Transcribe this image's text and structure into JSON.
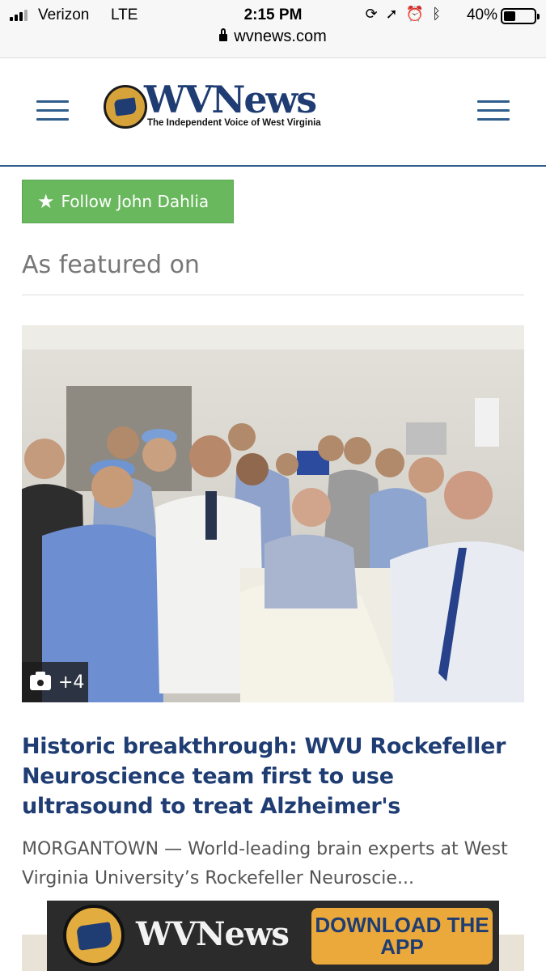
{
  "status_bar": {
    "carrier": "Verizon",
    "network": "LTE",
    "time": "2:15 PM",
    "battery": "40%",
    "battery_level": 0.4,
    "icons": [
      "screen-rotation-lock-icon",
      "location-arrow-icon",
      "alarm-icon",
      "bluetooth-icon"
    ]
  },
  "browser": {
    "url": "wvnews.com"
  },
  "header": {
    "logo_text": "WVNews",
    "tagline": "The Independent Voice of West Virginia",
    "brand_color": "#1f3d73",
    "accent_color": "#2f5d8c"
  },
  "follow": {
    "label": "Follow John Dahlia",
    "color": "#6ab85e"
  },
  "section": {
    "title": "As featured on"
  },
  "article": {
    "photo_count": "+4",
    "headline": "Historic breakthrough: WVU Rockefeller Neuroscience team first to use ultrasound to treat Alzheimer's",
    "summary": "MORGANTOWN — World-leading brain experts at West Virginia University’s Rockefeller Neuroscie..."
  },
  "app_banner": {
    "logo_text": "WVNews",
    "cta": "DOWNLOAD THE APP",
    "cta_color": "#eaa93a"
  }
}
